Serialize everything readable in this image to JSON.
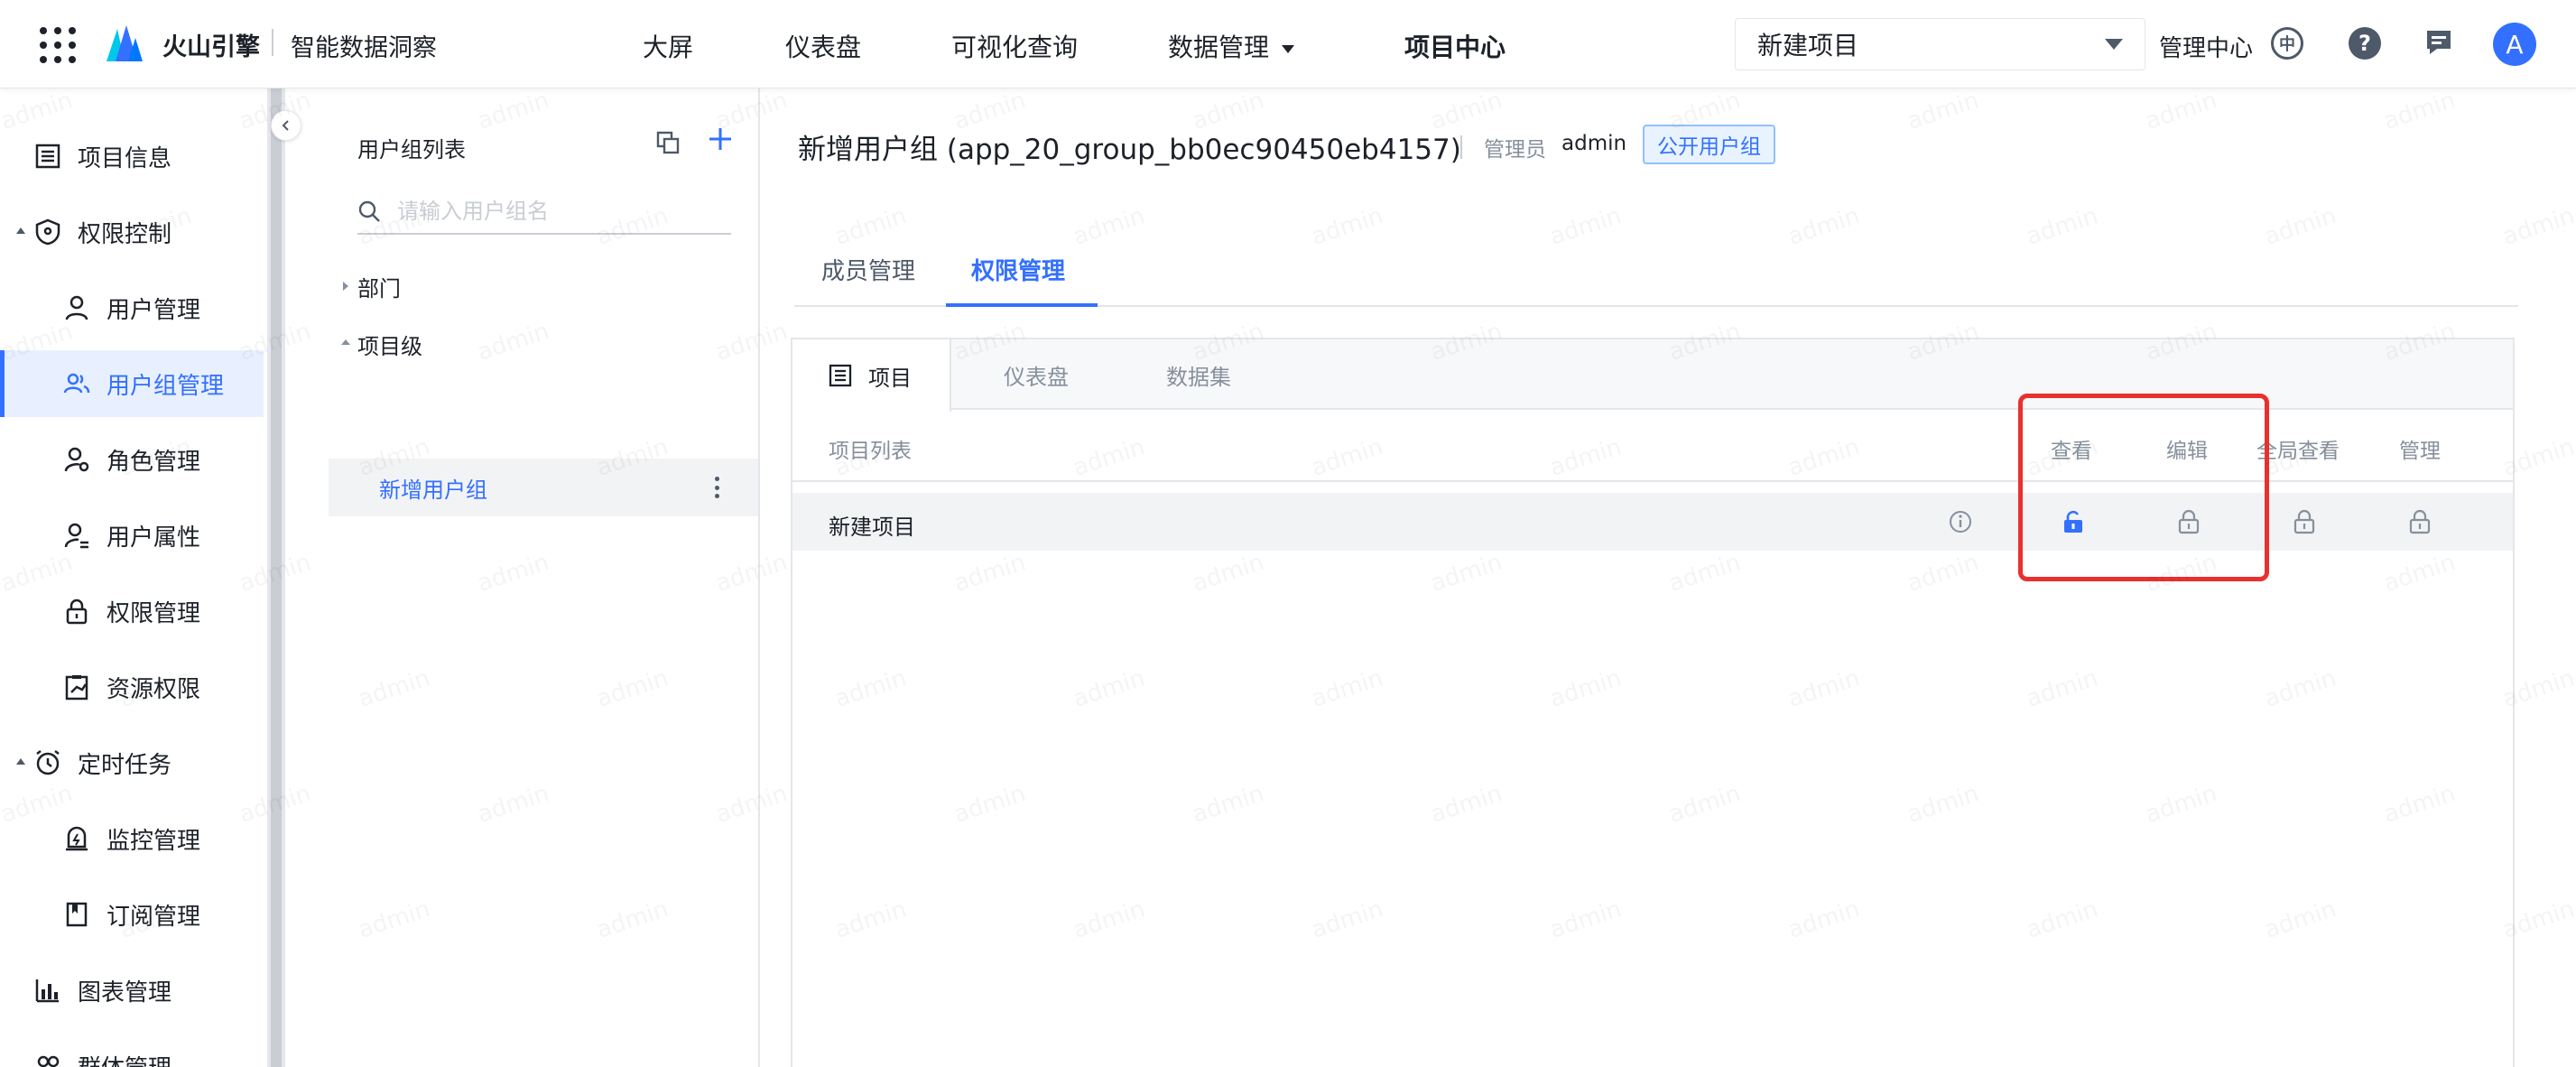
{
  "topbar": {
    "brand": "火山引擎",
    "product": "智能数据洞察",
    "nav": [
      {
        "label": "大屏"
      },
      {
        "label": "仪表盘"
      },
      {
        "label": "可视化查询"
      },
      {
        "label": "数据管理"
      },
      {
        "label": "项目中心"
      }
    ],
    "project_select": "新建项目",
    "admin_center": "管理中心",
    "language_glyph": "中",
    "help_glyph": "?",
    "avatar_letter": "A"
  },
  "sidebar": {
    "items": [
      {
        "label": "项目信息",
        "icon": "list-icon"
      },
      {
        "label": "权限控制",
        "icon": "shield-icon"
      },
      {
        "label": "用户管理",
        "icon": "user-icon"
      },
      {
        "label": "用户组管理",
        "icon": "users-icon",
        "active": true
      },
      {
        "label": "角色管理",
        "icon": "role-icon"
      },
      {
        "label": "用户属性",
        "icon": "user-attr-icon"
      },
      {
        "label": "权限管理",
        "icon": "lock-icon"
      },
      {
        "label": "资源权限",
        "icon": "resource-icon"
      },
      {
        "label": "定时任务",
        "icon": "alarm-icon"
      },
      {
        "label": "监控管理",
        "icon": "monitor-icon"
      },
      {
        "label": "订阅管理",
        "icon": "bookmark-icon"
      },
      {
        "label": "图表管理",
        "icon": "bar-chart-icon"
      },
      {
        "label": "群体管理",
        "icon": "group-icon"
      }
    ]
  },
  "group_panel": {
    "title": "用户组列表",
    "search_placeholder": "请输入用户组名",
    "tree": {
      "dept": "部门",
      "project_level": "项目级",
      "selected_group": "新增用户组"
    }
  },
  "main": {
    "title": "新增用户组 (app_20_group_bb0ec90450eb4157)",
    "owner_label": "管理员",
    "owner_value": "admin",
    "badge": "公开用户组",
    "tabs": [
      {
        "label": "成员管理"
      },
      {
        "label": "权限管理",
        "active": true
      }
    ],
    "resource_tabs": [
      {
        "label": "项目",
        "active": true
      },
      {
        "label": "仪表盘"
      },
      {
        "label": "数据集"
      }
    ],
    "columns": {
      "list": "项目列表",
      "view": "查看",
      "edit": "编辑",
      "global_view": "全局查看",
      "manage": "管理"
    },
    "rows": [
      {
        "name": "新建项目",
        "view": "unlocked",
        "edit": "locked",
        "global_view": "locked",
        "manage": "locked"
      }
    ]
  },
  "colors": {
    "accent": "#3370ff",
    "highlight": "#e8312f",
    "active_bg": "#e8f0ff"
  },
  "watermark": "admin"
}
